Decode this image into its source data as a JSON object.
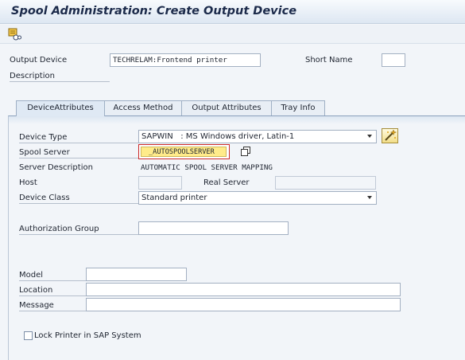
{
  "title": "Spool Administration: Create Output Device",
  "toolbar": {
    "icons": [
      "change-log-icon"
    ]
  },
  "header": {
    "output_device_label": "Output Device",
    "output_device_value": "TECHRELAM:Frontend printer",
    "short_name_label": "Short Name",
    "short_name_value": "",
    "description_label": "Description"
  },
  "tabs": [
    {
      "label": "DeviceAttributes",
      "active": true
    },
    {
      "label": "Access Method",
      "active": false
    },
    {
      "label": "Output Attributes",
      "active": false
    },
    {
      "label": "Tray Info",
      "active": false
    }
  ],
  "device": {
    "device_type_label": "Device Type",
    "device_type_value": "SAPWIN   : MS Windows driver, Latin-1",
    "spool_server_label": "Spool Server",
    "spool_server_value": "_AUTOSPOOLSERVER",
    "server_description_label": "Server Description",
    "server_description_value": "AUTOMATIC SPOOL SERVER MAPPING",
    "host_label": "Host",
    "host_value": "",
    "real_server_label": "Real Server",
    "real_server_value": "",
    "device_class_label": "Device Class",
    "device_class_value": "Standard printer",
    "authorization_group_label": "Authorization Group",
    "authorization_group_value": "",
    "model_label": "Model",
    "model_value": "",
    "location_label": "Location",
    "location_value": "",
    "message_label": "Message",
    "message_value": "",
    "lock_printer_label": "Lock Printer in SAP System",
    "lock_printer_checked": false
  },
  "colors": {
    "title": "#1b2a4a",
    "background": "#f2f5f9",
    "error_border": "#cc2a2a",
    "highlight": "#ffeb8a"
  }
}
